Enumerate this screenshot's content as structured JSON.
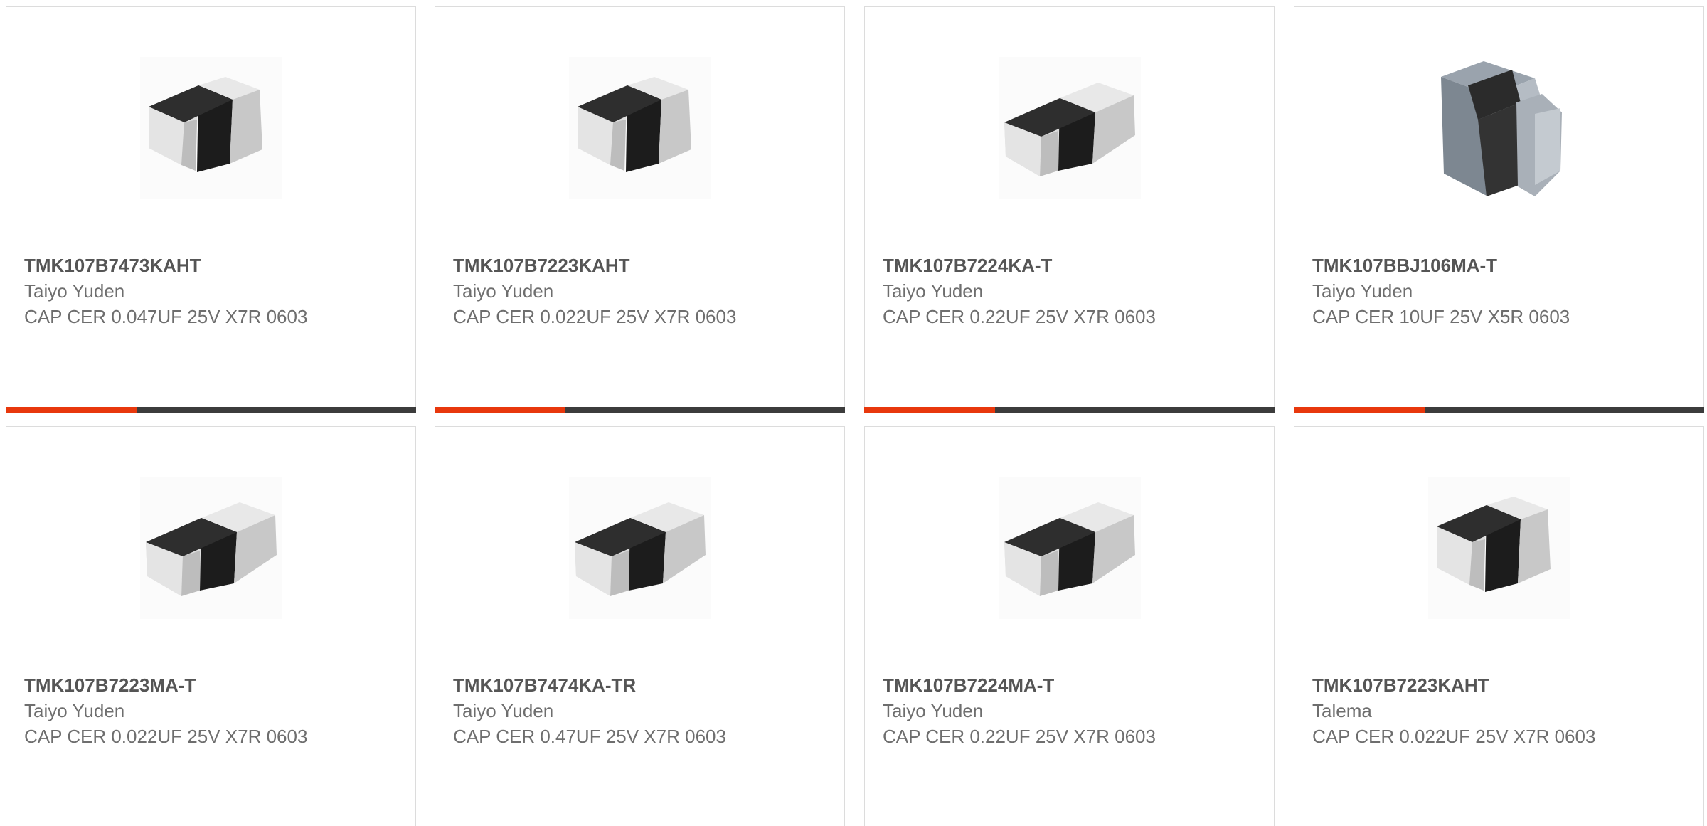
{
  "accent_color": "#e8380d",
  "bar_color": "#3c3c3c",
  "products": [
    {
      "part_number": "TMK107B7473KAHT",
      "manufacturer": "Taiyo Yuden",
      "description": "CAP CER 0.047UF 25V X7R 0603",
      "image_icon": "ceramic-capacitor-chip-icon"
    },
    {
      "part_number": "TMK107B7223KAHT",
      "manufacturer": "Taiyo Yuden",
      "description": "CAP CER 0.022UF 25V X7R 0603",
      "image_icon": "ceramic-capacitor-chip-icon"
    },
    {
      "part_number": "TMK107B7224KA-T",
      "manufacturer": "Taiyo Yuden",
      "description": "CAP CER 0.22UF 25V X7R 0603",
      "image_icon": "ceramic-capacitor-chip-icon"
    },
    {
      "part_number": "TMK107BBJ106MA-T",
      "manufacturer": "Taiyo Yuden",
      "description": "CAP CER 10UF 25V X5R 0603",
      "image_icon": "ceramic-capacitor-cube-icon"
    },
    {
      "part_number": "TMK107B7223MA-T",
      "manufacturer": "Taiyo Yuden",
      "description": "CAP CER 0.022UF 25V X7R 0603",
      "image_icon": "ceramic-capacitor-chip-icon"
    },
    {
      "part_number": "TMK107B7474KA-TR",
      "manufacturer": "Taiyo Yuden",
      "description": "CAP CER 0.47UF 25V X7R 0603",
      "image_icon": "ceramic-capacitor-chip-icon"
    },
    {
      "part_number": "TMK107B7224MA-T",
      "manufacturer": "Taiyo Yuden",
      "description": "CAP CER 0.22UF 25V X7R 0603",
      "image_icon": "ceramic-capacitor-chip-icon"
    },
    {
      "part_number": "TMK107B7223KAHT",
      "manufacturer": "Talema",
      "description": "CAP CER 0.022UF 25V X7R 0603",
      "image_icon": "ceramic-capacitor-chip-icon"
    }
  ]
}
